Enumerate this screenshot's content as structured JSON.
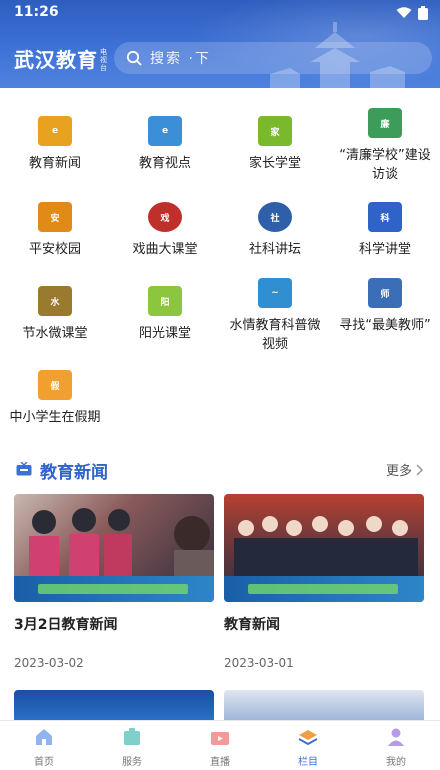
{
  "status": {
    "time": "11:26"
  },
  "header": {
    "brand": "武汉教育",
    "brand_sub": "电视台",
    "search_placeholder": "搜索 ·下"
  },
  "categories": [
    {
      "label": "教育新闻",
      "icon": "e-news-icon",
      "color": "#e0a020"
    },
    {
      "label": "教育视点",
      "icon": "e-view-icon",
      "color": "#3a8fd8"
    },
    {
      "label": "家长学堂",
      "icon": "parent-school-icon",
      "color": "#7ab82e"
    },
    {
      "label": "“清廉学校”建设访谈",
      "icon": "clean-school-icon",
      "color": "#3d9c5a"
    },
    {
      "label": "平安校园",
      "icon": "safe-campus-icon",
      "color": "#e08a1a"
    },
    {
      "label": "戏曲大课堂",
      "icon": "opera-icon",
      "color": "#c0302a"
    },
    {
      "label": "社科讲坛",
      "icon": "social-science-icon",
      "color": "#2f5fa8"
    },
    {
      "label": "科学讲堂",
      "icon": "science-icon",
      "color": "#2f63c8"
    },
    {
      "label": "节水微课堂",
      "icon": "water-saving-icon",
      "color": "#9a7a2e"
    },
    {
      "label": "阳光课堂",
      "icon": "sunshine-icon",
      "color": "#8cc63f"
    },
    {
      "label": "水情教育科普微视频",
      "icon": "water-education-icon",
      "color": "#2f8fd0"
    },
    {
      "label": "寻找“最美教师”",
      "icon": "best-teacher-icon",
      "color": "#3a6fb8"
    },
    {
      "label": "中小学生在假期",
      "icon": "holiday-icon",
      "color": "#f0a030"
    }
  ],
  "section": {
    "title": "教育新闻",
    "more": "更多"
  },
  "news": [
    {
      "title": "3月2日教育新闻",
      "date": "2023-03-02"
    },
    {
      "title": "教育新闻",
      "date": "2023-03-01"
    }
  ],
  "tabs": [
    {
      "label": "首页",
      "icon": "home-icon"
    },
    {
      "label": "服务",
      "icon": "service-icon"
    },
    {
      "label": "直播",
      "icon": "live-icon"
    },
    {
      "label": "栏目",
      "icon": "column-icon",
      "active": true
    },
    {
      "label": "我的",
      "icon": "profile-icon"
    }
  ],
  "colors": {
    "brand_blue": "#3a6fd6",
    "section_title": "#2f63c8"
  }
}
